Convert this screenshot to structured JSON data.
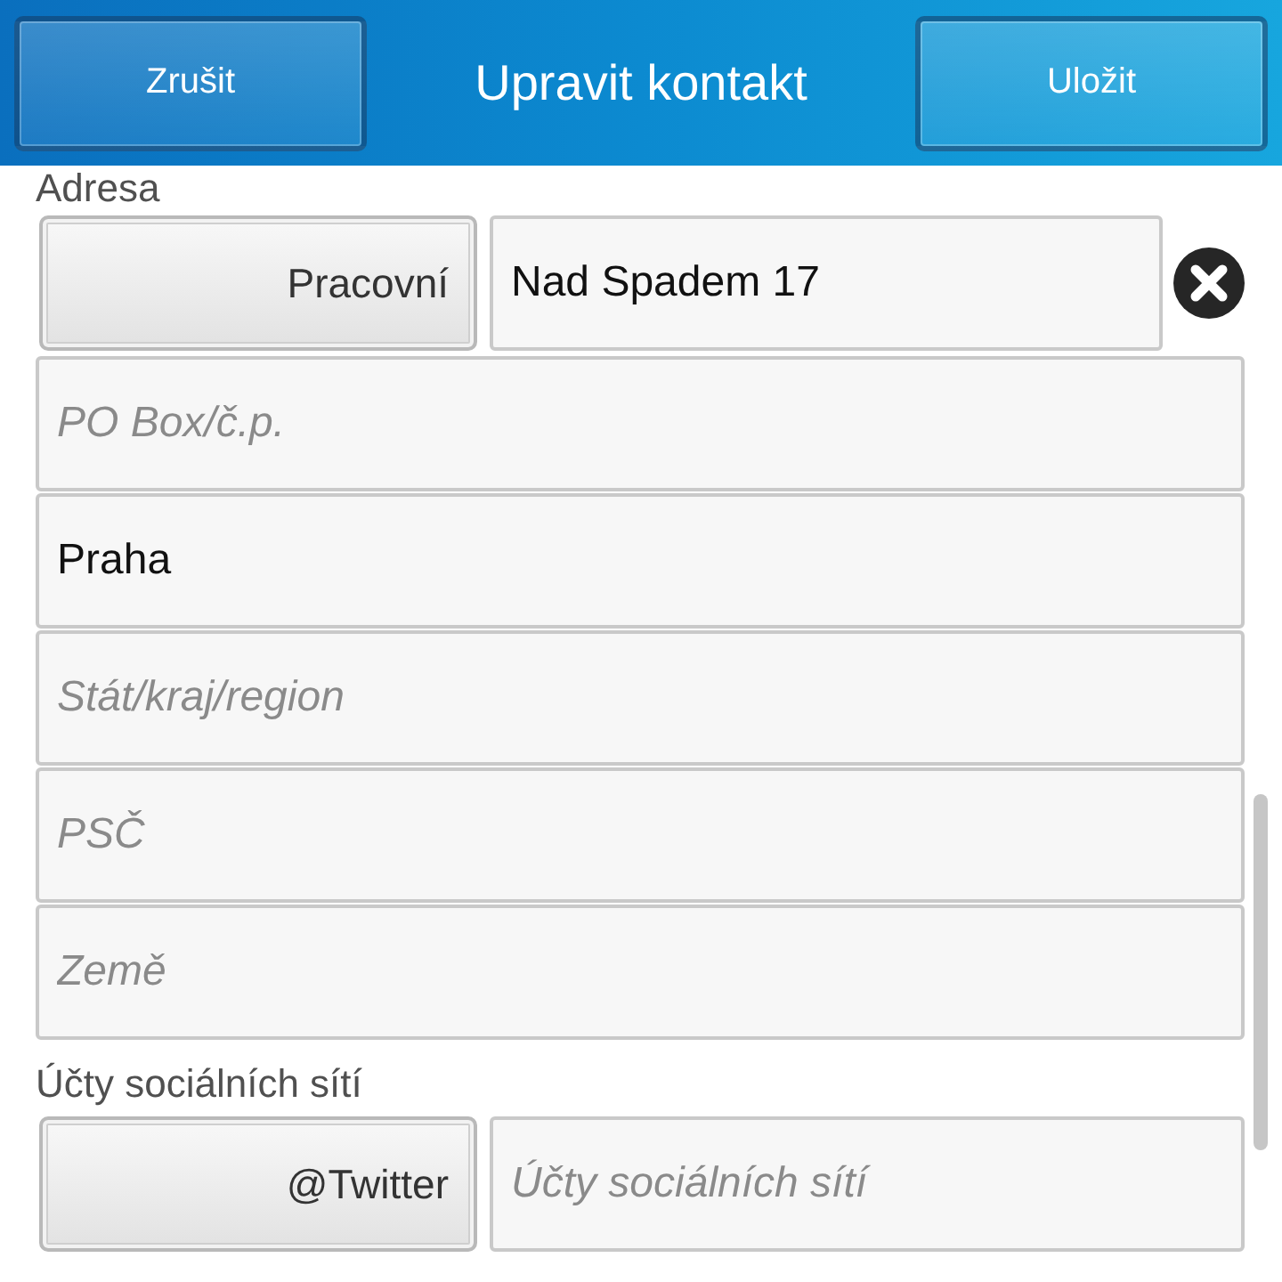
{
  "header": {
    "cancel_button": "Zrušit",
    "title": "Upravit kontakt",
    "save_button": "Uložit"
  },
  "sections": [
    {
      "label": "Adresa",
      "type_button": "Pracovní",
      "field": {
        "value": "Nad Spadem 17"
      },
      "clear_button": true,
      "extra_fields": [
        {
          "placeholder": "PO Box/č.p."
        },
        {
          "value": "Praha"
        },
        {
          "placeholder": "Stát/kraj/region"
        },
        {
          "placeholder": "PSČ"
        },
        {
          "placeholder": "Země"
        }
      ]
    },
    {
      "label": "Účty sociálních sítí",
      "type_button": "@Twitter",
      "field": {
        "placeholder": "Účty sociálních sítí"
      }
    }
  ]
}
